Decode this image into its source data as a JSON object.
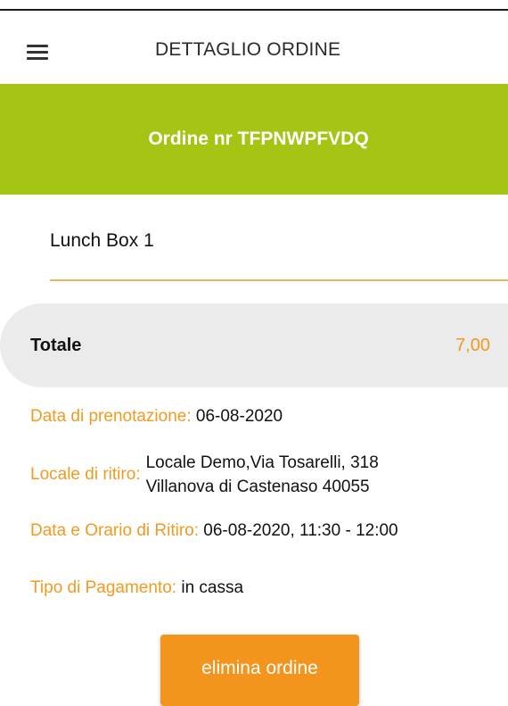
{
  "header": {
    "menu_icon": "hamburger-icon",
    "title": "DETTAGLIO ORDINE"
  },
  "order": {
    "title": "Ordine nr TFPNWPFVDQ",
    "items": [
      {
        "name": "Lunch Box 1"
      }
    ],
    "total_label": "Totale",
    "total_value": "7,00"
  },
  "details": {
    "booking_date_label": "Data di prenotazione:",
    "booking_date_value": "06-08-2020",
    "pickup_place_label": "Locale di ritiro:",
    "pickup_place_line1": "Locale Demo,Via Tosarelli, 318",
    "pickup_place_line2": "Villanova di Castenaso 40055",
    "pickup_time_label": "Data e Orario di Ritiro:",
    "pickup_time_value": "06-08-2020, 11:30 - 12:00",
    "payment_label": "Tipo di Pagamento:",
    "payment_value": "in cassa"
  },
  "actions": {
    "delete_label": "elimina ordine"
  },
  "colors": {
    "banner": "#a4c513",
    "accent": "#f29a1f",
    "button": "#f3941d",
    "total_bg": "#ebebeb"
  }
}
